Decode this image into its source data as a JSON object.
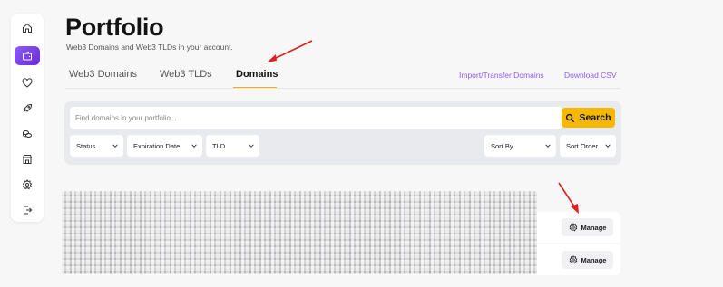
{
  "header": {
    "title": "Portfolio",
    "subtitle": "Web3 Domains and Web3 TLDs in your account."
  },
  "sidebar": {
    "items": [
      {
        "icon": "home-icon"
      },
      {
        "icon": "wallet-icon",
        "active": true
      },
      {
        "icon": "heart-icon"
      },
      {
        "icon": "rocket-icon"
      },
      {
        "icon": "coins-icon"
      },
      {
        "icon": "store-icon"
      },
      {
        "icon": "gear-icon"
      },
      {
        "icon": "logout-icon"
      }
    ]
  },
  "tabs": {
    "items": [
      {
        "label": "Web3 Domains"
      },
      {
        "label": "Web3 TLDs"
      },
      {
        "label": "Domains",
        "active": true
      }
    ],
    "links": {
      "import_transfer": "Import/Transfer Domains",
      "download_csv": "Download CSV"
    }
  },
  "search": {
    "placeholder": "Find domains in your portfolio...",
    "button_label": "Search"
  },
  "filters": {
    "status": "Status",
    "expiration_date": "Expiration Date",
    "tld": "TLD",
    "sort_by": "Sort By",
    "sort_order": "Sort Order"
  },
  "results": {
    "rows": [
      {
        "action_label": "Manage"
      },
      {
        "action_label": "Manage"
      }
    ]
  },
  "colors": {
    "accent": "#f5b800",
    "link": "#8b5cf6",
    "sidebar_active": "#7c3aed",
    "annotation_arrow": "#e02020"
  }
}
